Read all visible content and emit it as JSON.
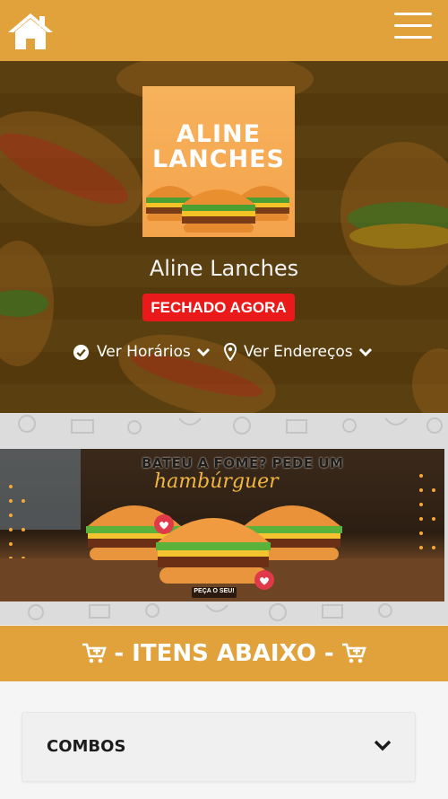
{
  "header": {
    "home_icon": "home-icon",
    "menu_icon": "hamburger-menu-icon"
  },
  "store": {
    "logo": {
      "line1": "ALINE",
      "line2": "LANCHES"
    },
    "name": "Aline Lanches",
    "status": "FECHADO AGORA",
    "hours_link": "Ver Horários",
    "address_link": "Ver Endereços"
  },
  "promo": {
    "title": "BATEU A FOME? PEDE UM",
    "script": "hambúrguer",
    "cta": "PEÇA O SEU!"
  },
  "items_header": {
    "label": "- ITENS ABAIXO -"
  },
  "categories": [
    {
      "label": "COMBOS"
    }
  ],
  "colors": {
    "brand": "#e1a23c",
    "status_red": "#ea1a1a",
    "logo_orange": "#f4a34b"
  }
}
